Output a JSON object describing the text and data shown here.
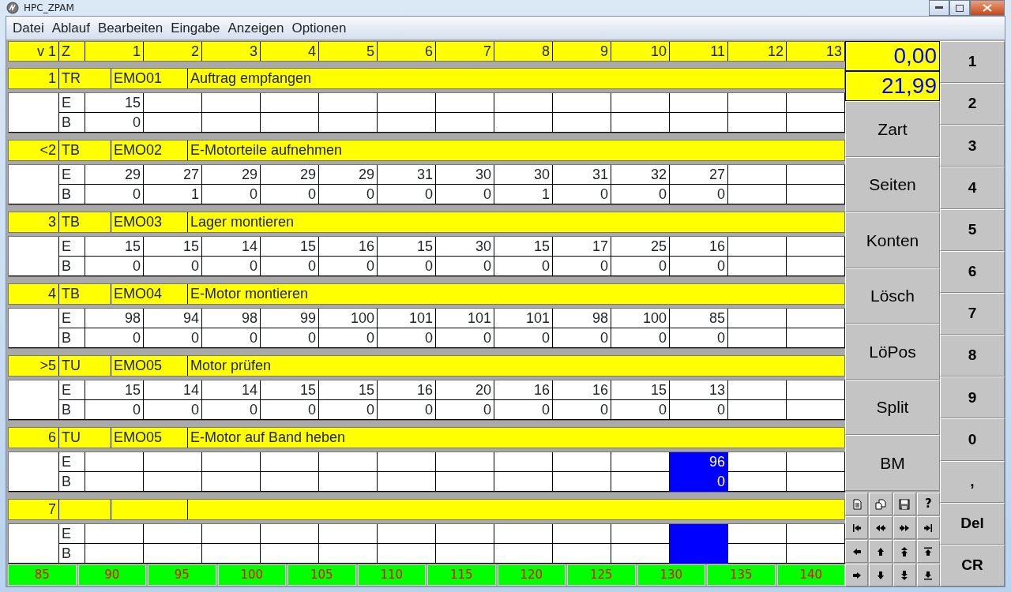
{
  "window": {
    "title": "HPC_ZPAM"
  },
  "menu": [
    "Datei",
    "Ablauf",
    "Bearbeiten",
    "Eingabe",
    "Anzeigen",
    "Optionen"
  ],
  "header": [
    "v 1",
    "Z",
    "1",
    "2",
    "3",
    "4",
    "5",
    "6",
    "7",
    "8",
    "9",
    "10",
    "11",
    "12",
    "13"
  ],
  "tasks": [
    {
      "marker": "1",
      "type": "TR",
      "code": "EMO01",
      "name": "Auftrag empfangen",
      "row_labels": [
        "E",
        "B"
      ],
      "columns": [
        {
          "e": "15",
          "b": "0",
          "highlighted": false
        },
        {
          "highlighted": false
        },
        {
          "highlighted": false
        },
        {
          "highlighted": false
        },
        {
          "highlighted": false
        },
        {
          "highlighted": false
        },
        {
          "highlighted": false
        },
        {
          "highlighted": false
        },
        {
          "highlighted": false
        },
        {
          "highlighted": false
        },
        {
          "highlighted": false
        },
        {
          "highlighted": false
        },
        {
          "highlighted": false
        }
      ]
    },
    {
      "marker": "<2",
      "type": "TB",
      "code": "EMO02",
      "name": "E-Motorteile aufnehmen",
      "row_labels": [
        "E",
        "B"
      ],
      "columns": [
        {
          "e": "29",
          "b": "0",
          "highlighted": false
        },
        {
          "e": "27",
          "b": "1",
          "highlighted": false
        },
        {
          "e": "29",
          "b": "0",
          "highlighted": false
        },
        {
          "e": "29",
          "b": "0",
          "highlighted": false
        },
        {
          "e": "29",
          "b": "0",
          "highlighted": false
        },
        {
          "e": "31",
          "b": "0",
          "highlighted": false
        },
        {
          "e": "30",
          "b": "0",
          "highlighted": false
        },
        {
          "e": "30",
          "b": "1",
          "highlighted": false
        },
        {
          "e": "31",
          "b": "0",
          "highlighted": false
        },
        {
          "e": "32",
          "b": "0",
          "highlighted": false
        },
        {
          "e": "27",
          "b": "0",
          "highlighted": false
        },
        {
          "highlighted": false
        },
        {
          "highlighted": false
        }
      ]
    },
    {
      "marker": "3",
      "type": "TB",
      "code": "EMO03",
      "name": "Lager montieren",
      "row_labels": [
        "E",
        "B"
      ],
      "columns": [
        {
          "e": "15",
          "b": "0",
          "highlighted": false
        },
        {
          "e": "15",
          "b": "0",
          "highlighted": false
        },
        {
          "e": "14",
          "b": "0",
          "highlighted": false
        },
        {
          "e": "15",
          "b": "0",
          "highlighted": false
        },
        {
          "e": "16",
          "b": "0",
          "highlighted": false
        },
        {
          "e": "15",
          "b": "0",
          "highlighted": false
        },
        {
          "e": "30",
          "b": "0",
          "highlighted": false
        },
        {
          "e": "15",
          "b": "0",
          "highlighted": false
        },
        {
          "e": "17",
          "b": "0",
          "highlighted": false
        },
        {
          "e": "25",
          "b": "0",
          "highlighted": false
        },
        {
          "e": "16",
          "b": "0",
          "highlighted": false
        },
        {
          "highlighted": false
        },
        {
          "highlighted": false
        }
      ]
    },
    {
      "marker": "4",
      "type": "TB",
      "code": "EMO04",
      "name": "E-Motor montieren",
      "row_labels": [
        "E",
        "B"
      ],
      "columns": [
        {
          "e": "98",
          "b": "0",
          "highlighted": false
        },
        {
          "e": "94",
          "b": "0",
          "highlighted": false
        },
        {
          "e": "98",
          "b": "0",
          "highlighted": false
        },
        {
          "e": "99",
          "b": "0",
          "highlighted": false
        },
        {
          "e": "100",
          "b": "0",
          "highlighted": false
        },
        {
          "e": "101",
          "b": "0",
          "highlighted": false
        },
        {
          "e": "101",
          "b": "0",
          "highlighted": false
        },
        {
          "e": "101",
          "b": "0",
          "highlighted": false
        },
        {
          "e": "98",
          "b": "0",
          "highlighted": false
        },
        {
          "e": "100",
          "b": "0",
          "highlighted": false
        },
        {
          "e": "85",
          "b": "0",
          "highlighted": false
        },
        {
          "highlighted": false
        },
        {
          "highlighted": false
        }
      ]
    },
    {
      "marker": ">5",
      "type": "TU",
      "code": "EMO05",
      "name": "Motor prüfen",
      "row_labels": [
        "E",
        "B"
      ],
      "columns": [
        {
          "e": "15",
          "b": "0",
          "highlighted": false
        },
        {
          "e": "14",
          "b": "0",
          "highlighted": false
        },
        {
          "e": "14",
          "b": "0",
          "highlighted": false
        },
        {
          "e": "15",
          "b": "0",
          "highlighted": false
        },
        {
          "e": "15",
          "b": "0",
          "highlighted": false
        },
        {
          "e": "16",
          "b": "0",
          "highlighted": false
        },
        {
          "e": "20",
          "b": "0",
          "highlighted": false
        },
        {
          "e": "16",
          "b": "0",
          "highlighted": false
        },
        {
          "e": "16",
          "b": "0",
          "highlighted": false
        },
        {
          "e": "15",
          "b": "0",
          "highlighted": false
        },
        {
          "e": "13",
          "b": "0",
          "highlighted": false
        },
        {
          "highlighted": false
        },
        {
          "highlighted": false
        }
      ]
    },
    {
      "marker": "6",
      "type": "TU",
      "code": "EMO05",
      "name": "E-Motor auf Band heben",
      "row_labels": [
        "E",
        "B"
      ],
      "columns": [
        {
          "highlighted": false
        },
        {
          "highlighted": false
        },
        {
          "highlighted": false
        },
        {
          "highlighted": false
        },
        {
          "highlighted": false
        },
        {
          "highlighted": false
        },
        {
          "highlighted": false
        },
        {
          "highlighted": false
        },
        {
          "highlighted": false
        },
        {
          "highlighted": false
        },
        {
          "e": "96",
          "b": "0",
          "highlighted": true
        },
        {
          "highlighted": false
        },
        {
          "highlighted": false
        }
      ]
    },
    {
      "marker": "7",
      "row_labels": [
        "E",
        "B"
      ],
      "columns": [
        {
          "highlighted": false
        },
        {
          "highlighted": false
        },
        {
          "highlighted": false
        },
        {
          "highlighted": false
        },
        {
          "highlighted": false
        },
        {
          "highlighted": false
        },
        {
          "highlighted": false
        },
        {
          "highlighted": false
        },
        {
          "highlighted": false
        },
        {
          "highlighted": false
        },
        {
          "highlighted": true
        },
        {
          "highlighted": false
        },
        {
          "highlighted": false
        }
      ]
    }
  ],
  "totals": [
    "0,00",
    "21,99"
  ],
  "function_buttons": [
    "Zart",
    "Seiten",
    "Konten",
    "Lösch",
    "LöPos",
    "Split",
    "BM"
  ],
  "toolbar": {
    "help": "?"
  },
  "keypad": [
    "1",
    "2",
    "3",
    "4",
    "5",
    "6",
    "7",
    "8",
    "9",
    "0",
    ",",
    "Del",
    "CR"
  ],
  "scale": [
    "85",
    "90",
    "95",
    "100",
    "105",
    "110",
    "115",
    "120",
    "125",
    "130",
    "135",
    "140"
  ]
}
